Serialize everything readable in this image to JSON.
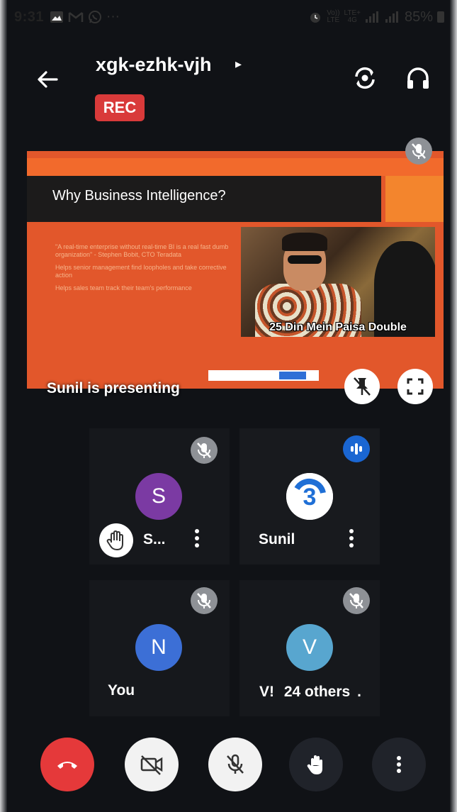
{
  "status_bar": {
    "time": "9:31",
    "left_icons": [
      "gallery-icon",
      "gmail-icon",
      "whatsapp-icon",
      "more-notifications-icon"
    ],
    "ellipsis": "···",
    "network_labels": [
      "Vo))",
      "LTE",
      "LTE+",
      "4G"
    ],
    "battery": "85%"
  },
  "header": {
    "meeting_code": "xgk-ezhk-vjh",
    "caret": "▸",
    "recording_badge": "REC",
    "icons": [
      "back-arrow-icon",
      "switch-camera-icon",
      "headphones-icon"
    ]
  },
  "presentation": {
    "slide_title": "Why Business Intelligence?",
    "bullets": [
      "\"A real-time enterprise without real-time BI is a real fast dumb organization\" - Stephen Bobit, CTO Teradata",
      "Helps senior management find loopholes and take corrective action",
      "Helps sales team track their team's performance"
    ],
    "image_caption": "25 Din Mein Paisa Double",
    "presenter_label": "Sunil is presenting"
  },
  "participants": [
    {
      "name": "S...",
      "initial": "S",
      "avatar_color": "#7b3aa3",
      "mic": "muted",
      "hand_raised": true
    },
    {
      "name": "Sunil",
      "initial": "",
      "avatar_color": "#ffffff",
      "mic": "speaking",
      "hand_raised": false
    },
    {
      "name": "You",
      "initial": "N",
      "avatar_color": "#3c6fd6",
      "mic": "muted",
      "hand_raised": false
    },
    {
      "name": "V!",
      "extra": "24 others",
      "initial": "V",
      "avatar_color": "#58a6cf",
      "mic": "muted",
      "hand_raised": false
    }
  ],
  "controls": [
    {
      "name": "end-call",
      "icon": "phone-hangup-icon",
      "color": "#e5393a"
    },
    {
      "name": "camera",
      "icon": "camera-off-icon",
      "state": "off"
    },
    {
      "name": "microphone",
      "icon": "mic-off-icon",
      "state": "off"
    },
    {
      "name": "raise-hand",
      "icon": "hand-icon"
    },
    {
      "name": "more-options",
      "icon": "more-vertical-icon"
    }
  ],
  "colors": {
    "background": "#101216",
    "rec_red": "#d93a3a",
    "slide_orange": "#e2572b",
    "speaking_blue": "#1a66d2"
  }
}
